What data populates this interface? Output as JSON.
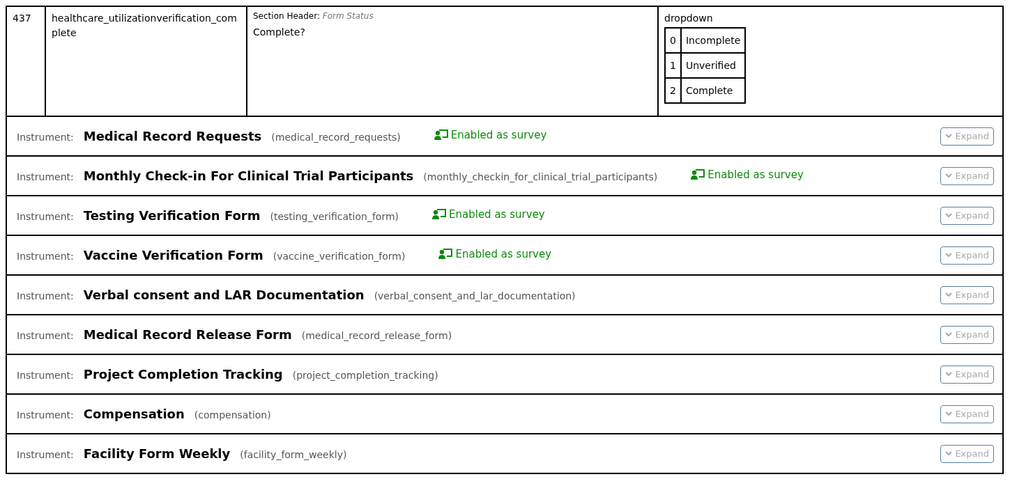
{
  "field_row": {
    "number": "437",
    "variable": "healthcare_utilizationverification_complete",
    "section_header_label": "Section Header:",
    "section_header": "Form Status",
    "label": "Complete?",
    "field_type": "dropdown",
    "choices": [
      {
        "value": "0",
        "label": "Incomplete"
      },
      {
        "value": "1",
        "label": "Unverified"
      },
      {
        "value": "2",
        "label": "Complete"
      }
    ]
  },
  "instruments": [
    {
      "prefix": "Instrument:",
      "title": "Medical Record Requests",
      "name": "(medical_record_requests)",
      "survey": "Enabled as survey",
      "button": "Expand"
    },
    {
      "prefix": "Instrument:",
      "title": "Monthly Check-in For Clinical Trial Participants",
      "name": "(monthly_checkin_for_clinical_trial_participants)",
      "survey": "Enabled as survey",
      "button": "Expand"
    },
    {
      "prefix": "Instrument:",
      "title": "Testing Verification Form",
      "name": "(testing_verification_form)",
      "survey": "Enabled as survey",
      "button": "Expand"
    },
    {
      "prefix": "Instrument:",
      "title": "Vaccine Verification Form",
      "name": "(vaccine_verification_form)",
      "survey": "Enabled as survey",
      "button": "Expand"
    },
    {
      "prefix": "Instrument:",
      "title": "Verbal consent and LAR Documentation",
      "name": "(verbal_consent_and_lar_documentation)",
      "button": "Expand"
    },
    {
      "prefix": "Instrument:",
      "title": "Medical Record Release Form",
      "name": "(medical_record_release_form)",
      "button": "Expand"
    },
    {
      "prefix": "Instrument:",
      "title": "Project Completion Tracking",
      "name": "(project_completion_tracking)",
      "button": "Expand"
    },
    {
      "prefix": "Instrument:",
      "title": "Compensation",
      "name": "(compensation)",
      "button": "Expand"
    },
    {
      "prefix": "Instrument:",
      "title": "Facility Form Weekly",
      "name": "(facility_form_weekly)",
      "button": "Expand"
    }
  ]
}
